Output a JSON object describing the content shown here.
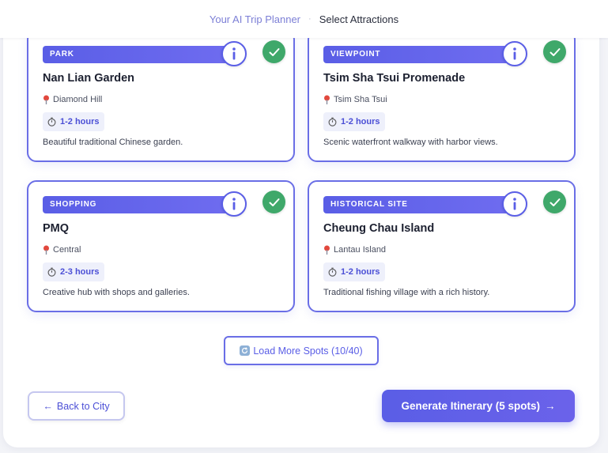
{
  "header": {
    "app_link": "Your AI Trip Planner",
    "separator": "·",
    "current": "Select Attractions"
  },
  "cards": [
    {
      "category": "PARK",
      "title": "Nan Lian Garden",
      "location": "Diamond Hill",
      "duration": "1-2 hours",
      "description": "Beautiful traditional Chinese garden.",
      "selected": true
    },
    {
      "category": "VIEWPOINT",
      "title": "Tsim Sha Tsui Promenade",
      "location": "Tsim Sha Tsui",
      "duration": "1-2 hours",
      "description": "Scenic waterfront walkway with harbor views.",
      "selected": true
    },
    {
      "category": "SHOPPING",
      "title": "PMQ",
      "location": "Central",
      "duration": "2-3 hours",
      "description": "Creative hub with shops and galleries.",
      "selected": true
    },
    {
      "category": "HISTORICAL SITE",
      "title": "Cheung Chau Island",
      "location": "Lantau Island",
      "duration": "1-2 hours",
      "description": "Traditional fishing village with a rich history.",
      "selected": true
    }
  ],
  "load_more": {
    "label": "Load More Spots (10/40)",
    "icon": "refresh-icon"
  },
  "footer": {
    "back_label": "Back to City",
    "back_arrow": "←",
    "generate_label": "Generate Itinerary (5 spots)",
    "generate_arrow": "→"
  },
  "colors": {
    "accent": "#5a5ee6",
    "selected_check": "#3fa86a",
    "card_border": "#6a6ee6"
  }
}
